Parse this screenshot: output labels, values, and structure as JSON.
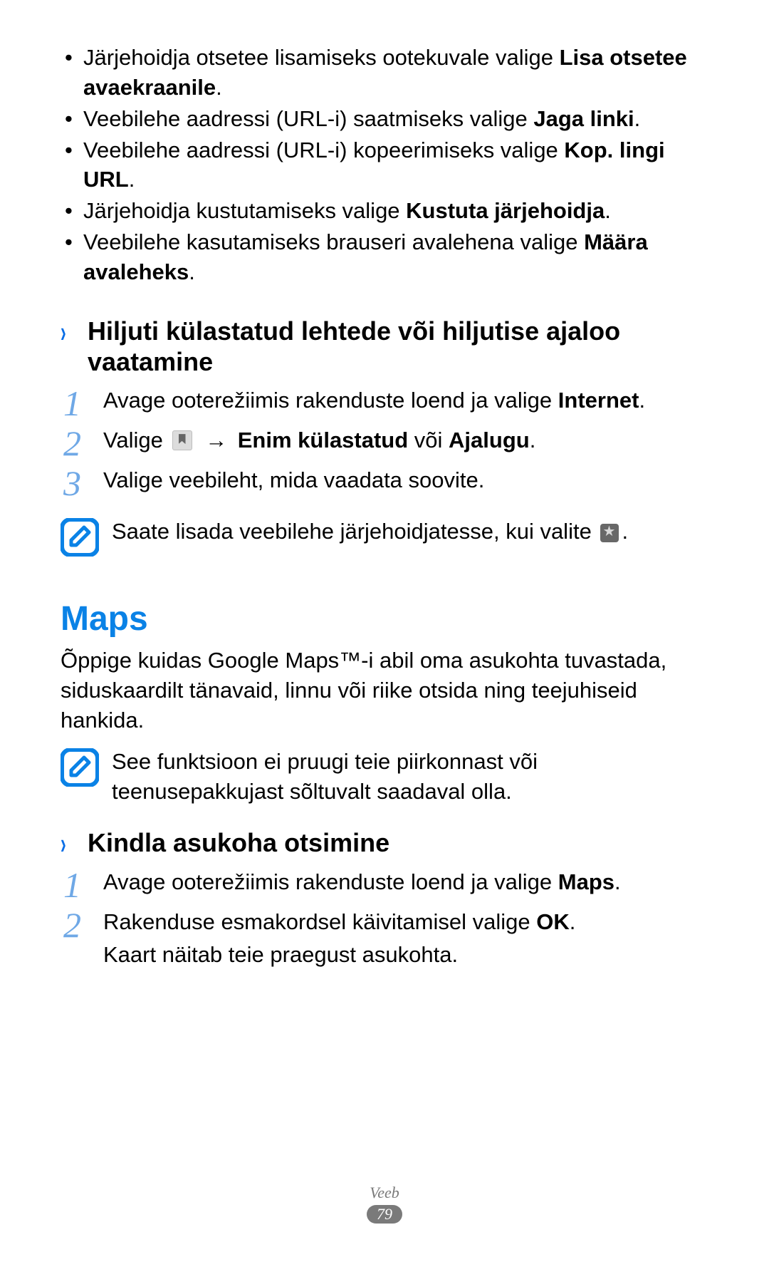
{
  "bullets": {
    "b1_pre": "Järjehoidja otsetee lisamiseks ootekuvale valige ",
    "b1_bold": "Lisa otsetee avaekraanile",
    "b1_post": ".",
    "b2_pre": "Veebilehe aadressi (URL-i) saatmiseks valige ",
    "b2_bold": "Jaga linki",
    "b2_post": ".",
    "b3_pre": "Veebilehe aadressi (URL-i) kopeerimiseks valige ",
    "b3_bold": "Kop. lingi URL",
    "b3_post": ".",
    "b4_pre": "Järjehoidja kustutamiseks valige ",
    "b4_bold": "Kustuta järjehoidja",
    "b4_post": ".",
    "b5_pre": "Veebilehe kasutamiseks brauseri avalehena valige ",
    "b5_bold": "Määra avaleheks",
    "b5_post": "."
  },
  "section1": {
    "heading": "Hiljuti külastatud lehtede või hiljutise ajaloo vaatamine",
    "step1_pre": "Avage ooterežiimis rakenduste loend ja valige ",
    "step1_bold": "Internet",
    "step1_post": ".",
    "step2_pre": "Valige ",
    "step2_bold1": "Enim külastatud",
    "step2_mid": " või ",
    "step2_bold2": "Ajalugu",
    "step2_post": ".",
    "step3": "Valige veebileht, mida vaadata soovite.",
    "note": "Saate lisada veebilehe järjehoidjatesse, kui valite ",
    "note_post": "."
  },
  "maps": {
    "title": "Maps",
    "intro": "Õppige kuidas Google Maps™-i abil oma asukohta tuvastada, siduskaardilt tänavaid, linnu või riike otsida ning teejuhiseid hankida.",
    "note": "See funktsioon ei pruugi teie piirkonnast või teenusepakkujast sõltuvalt saadaval olla."
  },
  "section2": {
    "heading": "Kindla asukoha otsimine",
    "step1_pre": "Avage ooterežiimis rakenduste loend ja valige ",
    "step1_bold": "Maps",
    "step1_post": ".",
    "step2_pre": "Rakenduse esmakordsel käivitamisel valige ",
    "step2_bold": "OK",
    "step2_post": ".",
    "step2_line2": "Kaart näitab teie praegust asukohta."
  },
  "numbers": {
    "n1": "1",
    "n2": "2",
    "n3": "3"
  },
  "footer": {
    "section": "Veeb",
    "page": "79"
  },
  "arrow": "→"
}
